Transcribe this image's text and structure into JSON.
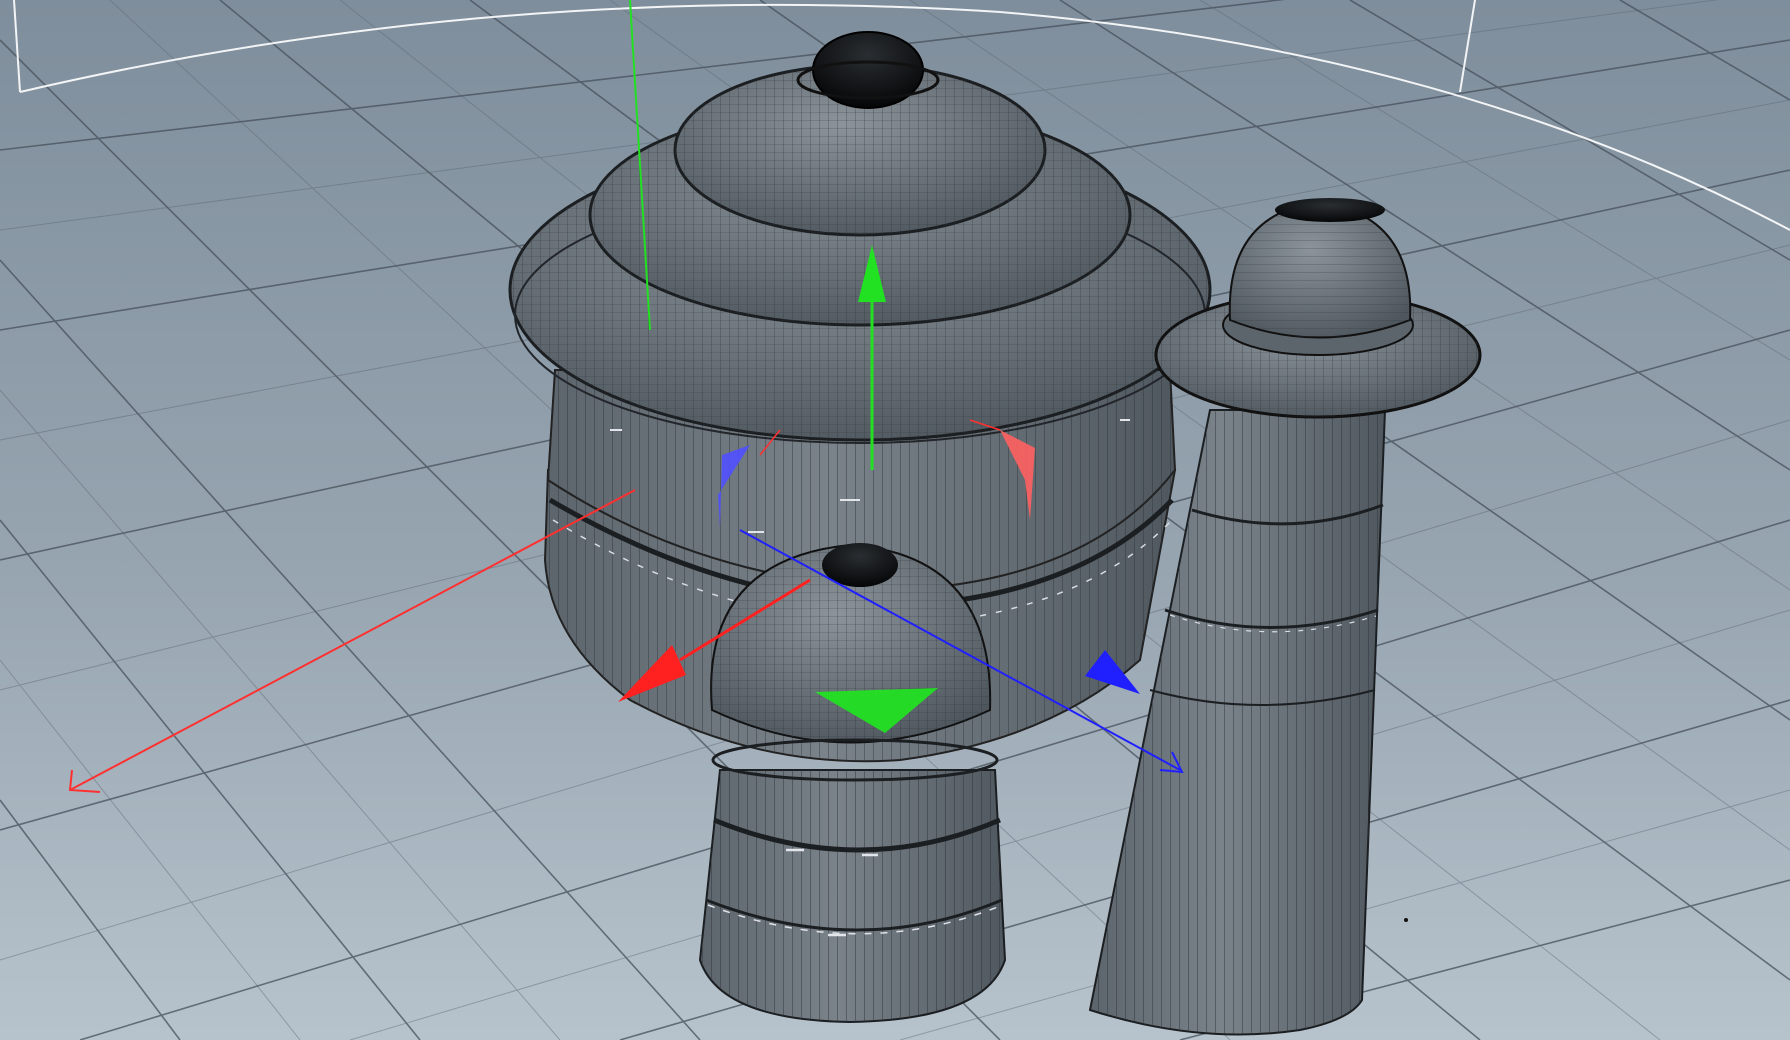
{
  "viewport": {
    "kind": "3D perspective viewport (no visible UI text)",
    "background_top": "#7f8e9c",
    "background_bottom": "#b8c4cd",
    "grid_color": "#4a5460"
  },
  "gizmo": {
    "x_axis_color": "#ff2020",
    "y_axis_color": "#22e022",
    "z_axis_color": "#2020ff",
    "rotate_handle_x_color": "#ff6060",
    "rotate_handle_z_color": "#4a4aff"
  },
  "objects": [
    {
      "name": "large-domed-hut",
      "material_color": "#6e767e"
    },
    {
      "name": "small-capsule-hut",
      "material_color": "#6b737b"
    },
    {
      "name": "tall-tower-with-cap",
      "material_color": "#697179"
    }
  ]
}
